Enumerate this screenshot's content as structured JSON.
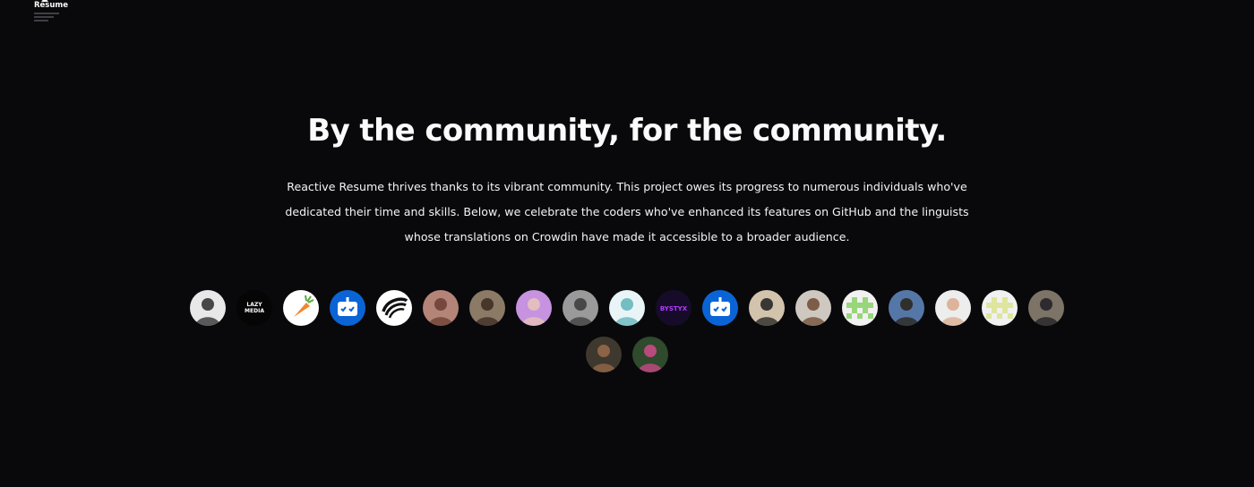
{
  "brand": {
    "name": "Resume"
  },
  "community": {
    "heading": "By the community, for the community.",
    "description": "Reactive Resume thrives thanks to its vibrant community. This project owes its progress to numerous individuals who've dedicated their time and skills. Below, we celebrate the coders who've enhanced its features on GitHub and the linguists whose translations on Crowdin have made it accessible to a broader audience."
  },
  "contributors": [
    {
      "kind": "photo",
      "bg": "#e8e8e8",
      "fg": "#2a2a2a"
    },
    {
      "kind": "text",
      "bg": "#050505",
      "fg": "#ffffff",
      "label": "LAZY MEDIA"
    },
    {
      "kind": "carrot-icon",
      "bg": "#ffffff",
      "fg": "#f2862b"
    },
    {
      "kind": "bot-icon",
      "bg": "#0b64d6",
      "fg": "#ffffff"
    },
    {
      "kind": "swoosh-icon",
      "bg": "#ffffff",
      "fg": "#111111"
    },
    {
      "kind": "photo",
      "bg": "#b48478",
      "fg": "#6b3d32"
    },
    {
      "kind": "photo",
      "bg": "#8a7a66",
      "fg": "#3b2a20"
    },
    {
      "kind": "photo",
      "bg": "#c792e0",
      "fg": "#e8c4b8"
    },
    {
      "kind": "photo",
      "bg": "#9a9a9a",
      "fg": "#3a3a3a"
    },
    {
      "kind": "photo",
      "bg": "#e8f4f6",
      "fg": "#5fb3b9"
    },
    {
      "kind": "text",
      "bg": "#160c2a",
      "fg": "#b43cff",
      "label": "BYSTYX"
    },
    {
      "kind": "bot-icon",
      "bg": "#0b64d6",
      "fg": "#ffffff"
    },
    {
      "kind": "photo",
      "bg": "#d2c3ad",
      "fg": "#1f1f1f"
    },
    {
      "kind": "photo",
      "bg": "#cfc8c0",
      "fg": "#6f4a32"
    },
    {
      "kind": "pixel-icon",
      "bg": "#f1f1f1",
      "fg": "#98d67a"
    },
    {
      "kind": "photo",
      "bg": "#5577a8",
      "fg": "#2a2216"
    },
    {
      "kind": "photo",
      "bg": "#ededed",
      "fg": "#d7a98b"
    },
    {
      "kind": "pixel-icon",
      "bg": "#f1f1f1",
      "fg": "#dfe59d"
    },
    {
      "kind": "photo",
      "bg": "#7d7366",
      "fg": "#1e1e24"
    },
    {
      "kind": "photo",
      "bg": "#3e382e",
      "fg": "#9a6b4a"
    },
    {
      "kind": "photo",
      "bg": "#2f4a2c",
      "fg": "#d04a8b"
    }
  ]
}
